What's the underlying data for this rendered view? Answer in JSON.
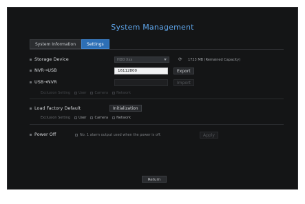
{
  "title": "System Management",
  "tabs": [
    {
      "label": "System Information"
    },
    {
      "label": "Settings"
    }
  ],
  "storage": {
    "label": "Storage Device",
    "device_value": "HDD Xxx",
    "refresh_icon": "refresh-icon",
    "capacity": "1723 MB  (Remained Capacity)"
  },
  "nvr_usb": {
    "label": "NVR→USB",
    "value": "16112800",
    "export_label": "Export"
  },
  "usb_nvr": {
    "label": "USB→NVR",
    "import_label": "Import"
  },
  "exclusion1": {
    "label": "Exclusion Setting",
    "options": [
      "User",
      "Camera",
      "Network"
    ]
  },
  "factory": {
    "label": "Load Factory Default",
    "button_label": "Initialization"
  },
  "exclusion2": {
    "label": "Exclusion Setting",
    "options": [
      "User",
      "Camera",
      "Network"
    ]
  },
  "power": {
    "label": "Power Off",
    "description": "No. 1 alarm output used when the power is off.",
    "apply_label": "Apply"
  },
  "footer": {
    "return_label": "Return"
  }
}
